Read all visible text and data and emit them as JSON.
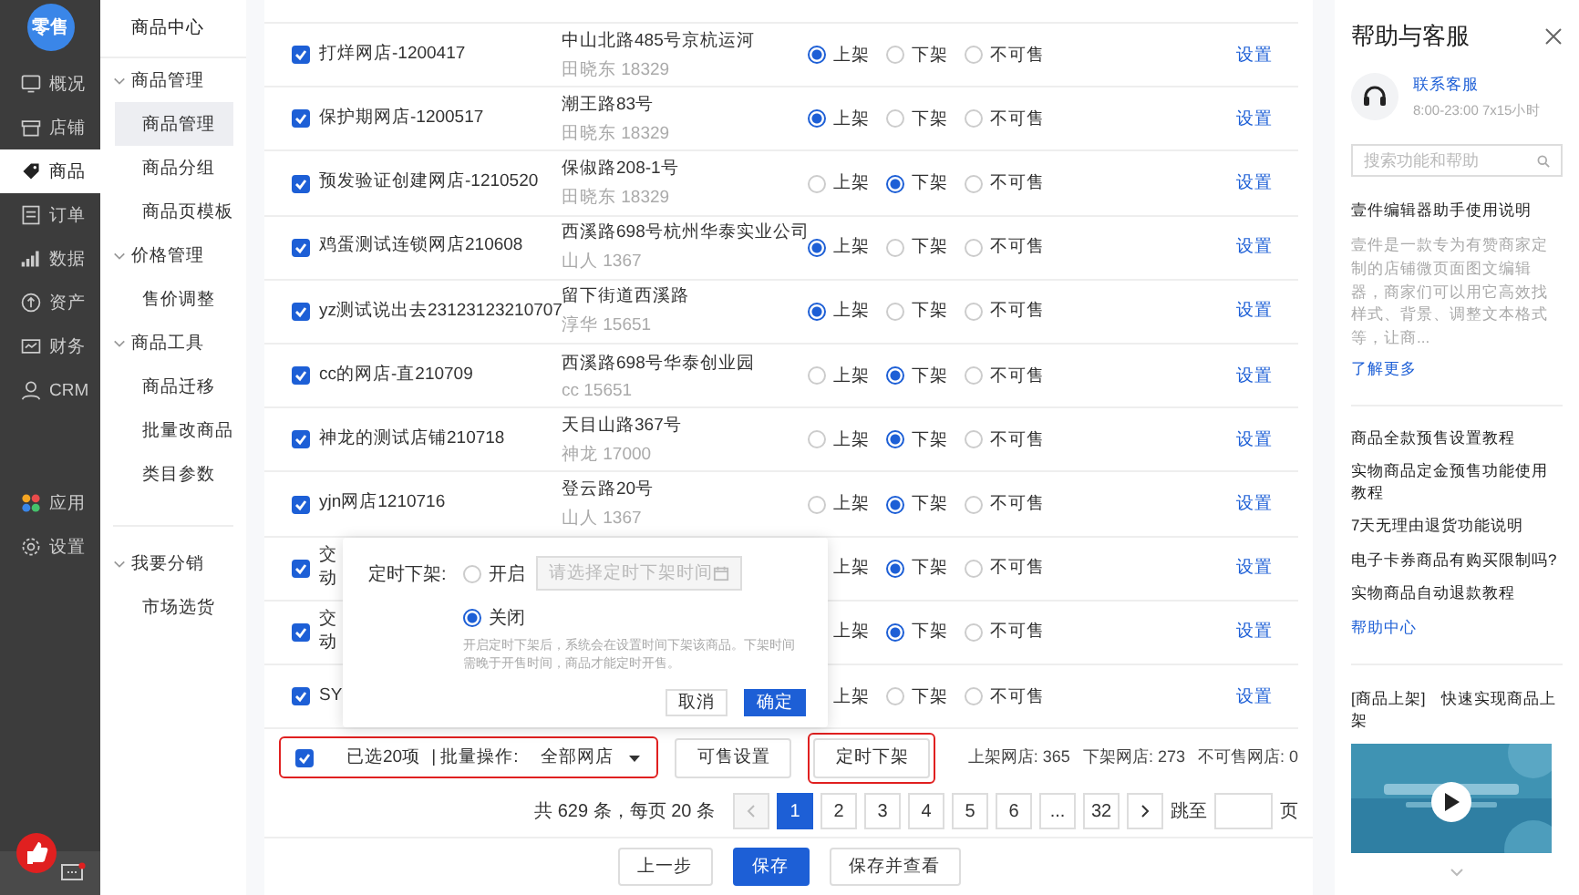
{
  "nav": {
    "logo": "零售",
    "items": [
      {
        "label": "概况",
        "selected": false
      },
      {
        "label": "店铺",
        "selected": false
      },
      {
        "label": "商品",
        "selected": true
      },
      {
        "label": "订单",
        "selected": false
      },
      {
        "label": "数据",
        "selected": false
      },
      {
        "label": "资产",
        "selected": false
      },
      {
        "label": "财务",
        "selected": false
      },
      {
        "label": "CRM",
        "selected": false
      }
    ],
    "bottom_items": [
      {
        "label": "应用",
        "selected": false
      },
      {
        "label": "设置",
        "selected": false
      }
    ],
    "chat_unread": true
  },
  "submenu": {
    "title": "商品中心",
    "groups": [
      {
        "label": "商品管理",
        "expanded": true,
        "children": [
          {
            "label": "商品管理",
            "selected": true
          },
          {
            "label": "商品分组",
            "selected": false
          },
          {
            "label": "商品页模板",
            "selected": false
          }
        ]
      },
      {
        "label": "价格管理",
        "expanded": true,
        "children": [
          {
            "label": "售价调整",
            "selected": false
          }
        ]
      },
      {
        "label": "商品工具",
        "expanded": true,
        "children": [
          {
            "label": "商品迁移",
            "selected": false
          },
          {
            "label": "批量改商品",
            "selected": false
          },
          {
            "label": "类目参数",
            "selected": false
          }
        ]
      },
      {
        "label": "我要分销",
        "expanded": true,
        "divider_before": true,
        "children": [
          {
            "label": "市场选货",
            "selected": false
          }
        ]
      }
    ]
  },
  "rows": [
    {
      "checked": true,
      "name": [
        "打烊网店-1200417"
      ],
      "address": "中山北路485号京杭运河",
      "contact": "田晓东 18329",
      "options": [
        {
          "label": "上架",
          "selected": true
        },
        {
          "label": "下架",
          "selected": false
        },
        {
          "label": "不可售",
          "selected": false
        }
      ],
      "action": "设置"
    },
    {
      "checked": true,
      "name": [
        "保护期网店-1200517"
      ],
      "address": "潮王路83号",
      "contact": "田晓东 18329",
      "options": [
        {
          "label": "上架",
          "selected": true
        },
        {
          "label": "下架",
          "selected": false
        },
        {
          "label": "不可售",
          "selected": false
        }
      ],
      "action": "设置"
    },
    {
      "checked": true,
      "name": [
        "预发验证创建网店-1210520"
      ],
      "address": "保俶路208-1号",
      "contact": "田晓东 18329",
      "options": [
        {
          "label": "上架",
          "selected": false
        },
        {
          "label": "下架",
          "selected": true
        },
        {
          "label": "不可售",
          "selected": false
        }
      ],
      "action": "设置"
    },
    {
      "checked": true,
      "name": [
        "鸡蛋测试连锁网店210608"
      ],
      "address": "西溪路698号杭州华泰实业公司",
      "contact": "山人 1367",
      "options": [
        {
          "label": "上架",
          "selected": true
        },
        {
          "label": "下架",
          "selected": false
        },
        {
          "label": "不可售",
          "selected": false
        }
      ],
      "action": "设置"
    },
    {
      "checked": true,
      "name": [
        "yz测试说出去23123123210707"
      ],
      "address": "留下街道西溪路",
      "contact": "淳华 15651",
      "options": [
        {
          "label": "上架",
          "selected": true
        },
        {
          "label": "下架",
          "selected": false
        },
        {
          "label": "不可售",
          "selected": false
        }
      ],
      "action": "设置"
    },
    {
      "checked": true,
      "name": [
        "cc的网店-直210709"
      ],
      "address": "西溪路698号华泰创业园",
      "contact": "cc 15651",
      "options": [
        {
          "label": "上架",
          "selected": false
        },
        {
          "label": "下架",
          "selected": true
        },
        {
          "label": "不可售",
          "selected": false
        }
      ],
      "action": "设置"
    },
    {
      "checked": true,
      "name": [
        "神龙的测试店铺210718"
      ],
      "address": "天目山路367号",
      "contact": "神龙 17000",
      "options": [
        {
          "label": "上架",
          "selected": false
        },
        {
          "label": "下架",
          "selected": true
        },
        {
          "label": "不可售",
          "selected": false
        }
      ],
      "action": "设置"
    },
    {
      "checked": true,
      "name": [
        "yjn网店1210716"
      ],
      "address": "登云路20号",
      "contact": "山人 1367",
      "options": [
        {
          "label": "上架",
          "selected": false
        },
        {
          "label": "下架",
          "selected": true
        },
        {
          "label": "不可售",
          "selected": false
        }
      ],
      "action": "设置"
    },
    {
      "checked": true,
      "name": [
        "交",
        "动"
      ],
      "options": [
        {
          "label": "上架"
        },
        {
          "label": "下架",
          "selected": true
        },
        {
          "label": "不可售",
          "selected": false
        }
      ],
      "action": "设置"
    },
    {
      "checked": true,
      "name": [
        "交",
        "动"
      ],
      "options": [
        {
          "label": "上架"
        },
        {
          "label": "下架",
          "selected": true
        },
        {
          "label": "不可售",
          "selected": false
        }
      ],
      "action": "设置"
    },
    {
      "checked": true,
      "name": [
        "SY"
      ],
      "options": [
        {
          "label": "上架"
        },
        {
          "label": "下架",
          "selected": false
        },
        {
          "label": "不可售",
          "selected": false
        }
      ],
      "action": "设置"
    }
  ],
  "popup": {
    "label": "定时下架:",
    "options": [
      {
        "label": "开启",
        "selected": false
      },
      {
        "label": "关闭",
        "selected": true
      }
    ],
    "date_placeholder": "请选择定时下架时间",
    "hint": "开启定时下架后，系统会在设置时间下架该商品。下架时间需晚于开售时间，商品才能定时开售。",
    "cancel": "取消",
    "confirm": "确定"
  },
  "bulk_bar": {
    "checked": true,
    "highlighted": true,
    "selected_text": "已选20项",
    "batch_label": "| 批量操作:",
    "scope": "全部网店",
    "buttons": [
      {
        "label": "可售设置",
        "highlighted": false
      },
      {
        "label": "定时下架",
        "highlighted": true
      }
    ],
    "stats": [
      "上架网店: 365",
      "下架网店: 273",
      "不可售网店: 0"
    ]
  },
  "pagination": {
    "total": "共 629 条，每页 20 条",
    "pages": [
      {
        "label": "1",
        "selected": true
      },
      {
        "label": "2",
        "selected": false
      },
      {
        "label": "3",
        "selected": false
      },
      {
        "label": "4",
        "selected": false
      },
      {
        "label": "5",
        "selected": false
      },
      {
        "label": "6",
        "selected": false
      },
      {
        "label": "...",
        "selected": false
      },
      {
        "label": "32",
        "selected": false
      }
    ],
    "jump_label": "跳至",
    "page_unit": "页"
  },
  "footer": [
    {
      "label": "上一步",
      "kind": "default"
    },
    {
      "label": "保存",
      "kind": "primary"
    },
    {
      "label": "保存并查看",
      "kind": "default"
    }
  ],
  "help": {
    "title": "帮助与客服",
    "contact": "联系客服",
    "hours": "8:00-23:00  7x15小时",
    "search_placeholder": "搜索功能和帮助",
    "article_title": "壹件编辑器助手使用说明",
    "article_text": "壹件是一款专为有赞商家定制的店铺微页面图文编辑器，商家们可以用它高效找样式、背景、调整文本格式等，让商...",
    "more": "了解更多",
    "links": [
      "商品全款预售设置教程",
      "实物商品定金预售功能使用教程",
      "7天无理由退货功能说明",
      "电子卡券商品有购买限制吗?",
      "实物商品自动退款教程"
    ],
    "center": "帮助中心",
    "video_caption": "[商品上架]　快速实现商品上架"
  }
}
